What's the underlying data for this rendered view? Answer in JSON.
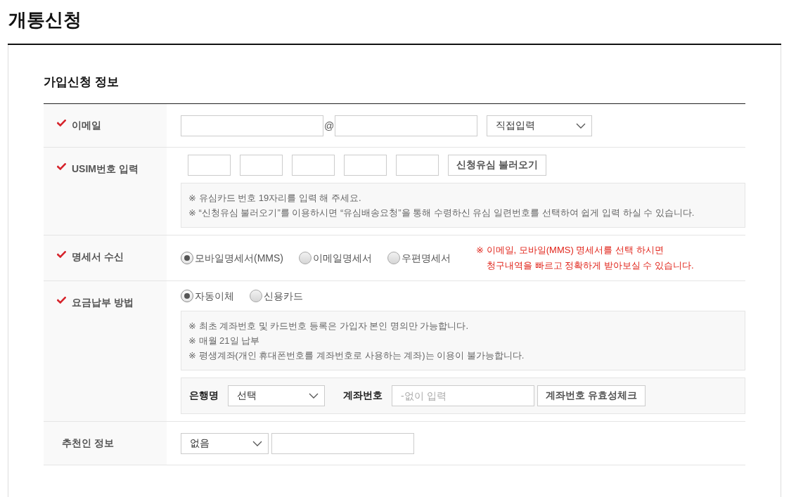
{
  "page": {
    "title": "개통신청"
  },
  "section": {
    "title": "가입신청 정보"
  },
  "rows": [
    {
      "kind": "email",
      "label": "이메일",
      "required": true,
      "blocks": [
        {
          "kind": "controls",
          "items": [
            {
              "kind": "input"
            },
            {
              "kind": "text",
              "text": "@"
            },
            {
              "kind": "input"
            },
            {
              "kind": "select",
              "value": "직접입력"
            }
          ]
        }
      ]
    },
    {
      "kind": "usim",
      "label": "USIM번호 입력",
      "required": true,
      "blocks": [
        {
          "kind": "controls",
          "items": [
            {
              "kind": "segment"
            },
            {
              "kind": "segment"
            },
            {
              "kind": "segment"
            },
            {
              "kind": "segment"
            },
            {
              "kind": "segment"
            },
            {
              "kind": "button",
              "text": "신청유심 불러오기"
            }
          ]
        },
        {
          "kind": "notes",
          "lines": [
            "※ 유심카드 번호 19자리를 입력 해 주세요.",
            "※ “신청유심 불러오기”를 이용하시면 “유심배송요청”을 통해 수령하신 유심 일련번호를 선택하여 쉽게 입력 하실 수 있습니다."
          ]
        }
      ]
    },
    {
      "kind": "statement",
      "label": "명세서 수신",
      "required": true,
      "blocks": [
        {
          "kind": "controls",
          "items": [
            {
              "kind": "radio",
              "label": "모바일명세서(MMS)",
              "selected": true
            },
            {
              "kind": "radio",
              "label": "이메일명세서",
              "selected": false
            },
            {
              "kind": "radio",
              "label": "우편명세서",
              "selected": false
            },
            {
              "kind": "notice",
              "lines": [
                "※ 이메일, 모바일(MMS) 명세서를 선택 하시면",
                "청구내역을 빠르고 정확하게 받아보실 수 있습니다."
              ]
            }
          ]
        }
      ]
    },
    {
      "kind": "payment",
      "label": "요금납부 방법",
      "required": true,
      "blocks": [
        {
          "kind": "controls",
          "items": [
            {
              "kind": "radio",
              "label": "자동이체",
              "selected": true
            },
            {
              "kind": "radio",
              "label": "신용카드",
              "selected": false
            }
          ]
        },
        {
          "kind": "notes",
          "lines": [
            "※ 최초 계좌번호 및 카드번호 등록은 가입자 본인 명의만 가능합니다.",
            "※ 매월 21일 납부",
            "※ 평생계좌(개인 휴대폰번호를 계좌번호로 사용하는 계좌)는 이용이 불가능합니다."
          ]
        },
        {
          "kind": "panel",
          "items": [
            {
              "kind": "label",
              "text": "은행명"
            },
            {
              "kind": "select",
              "value": "선택"
            },
            {
              "kind": "label",
              "text": "계좌번호"
            },
            {
              "kind": "input",
              "placeholder": "-없이 입력"
            },
            {
              "kind": "button",
              "text": "계좌번호 유효성체크"
            }
          ]
        }
      ]
    },
    {
      "kind": "referrer",
      "label": "추천인 정보",
      "required": false,
      "blocks": [
        {
          "kind": "controls",
          "items": [
            {
              "kind": "select",
              "value": "없음"
            },
            {
              "kind": "input"
            }
          ]
        }
      ]
    }
  ]
}
